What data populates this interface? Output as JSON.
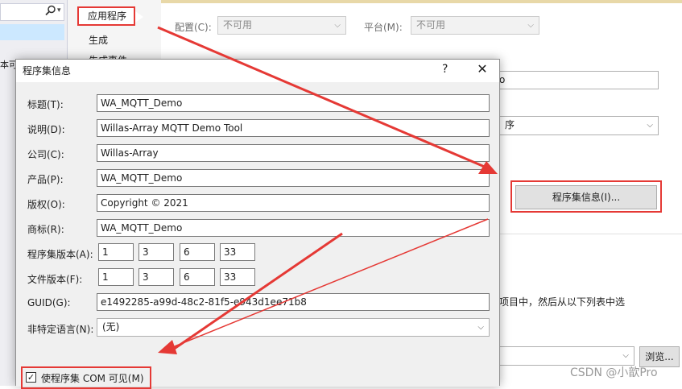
{
  "nav": {
    "items": [
      "应用程序",
      "生成",
      "生成事件"
    ]
  },
  "left_panel": {
    "fragment": "本可"
  },
  "config": {
    "config_label": "配置(C):",
    "config_value": "不可用",
    "platform_label": "平台(M):",
    "platform_value": "不可用"
  },
  "background": {
    "input1_fragment": "o",
    "combo2_fragment": "序",
    "assembly_info_button": "程序集信息(I)...",
    "text_fragment": "项目中，然后从以下列表中选",
    "browse_button": "浏览..."
  },
  "dialog": {
    "title": "程序集信息",
    "help": "?",
    "close": "✕",
    "fields": [
      {
        "label": "标题(T):",
        "value": "WA_MQTT_Demo"
      },
      {
        "label": "说明(D):",
        "value": "Willas-Array MQTT Demo Tool"
      },
      {
        "label": "公司(C):",
        "value": "Willas-Array"
      },
      {
        "label": "产品(P):",
        "value": "WA_MQTT_Demo"
      },
      {
        "label": "版权(O):",
        "value": "Copyright ©  2021"
      },
      {
        "label": "商标(R):",
        "value": "WA_MQTT_Demo"
      }
    ],
    "assembly_version": {
      "label": "程序集版本(A):",
      "values": [
        "1",
        "3",
        "6",
        "33"
      ]
    },
    "file_version": {
      "label": "文件版本(F):",
      "values": [
        "1",
        "3",
        "6",
        "33"
      ]
    },
    "guid": {
      "label": "GUID(G):",
      "value": "e1492285-a99d-48c2-81f5-e943d1ee71b8"
    },
    "language": {
      "label": "非特定语言(N):",
      "value": "(无)"
    },
    "com_visible": {
      "label": "使程序集 COM 可见(M)",
      "checked": true
    }
  },
  "watermark": "CSDN @小歆Pro",
  "colors": {
    "annotation_red": "#e53935"
  }
}
